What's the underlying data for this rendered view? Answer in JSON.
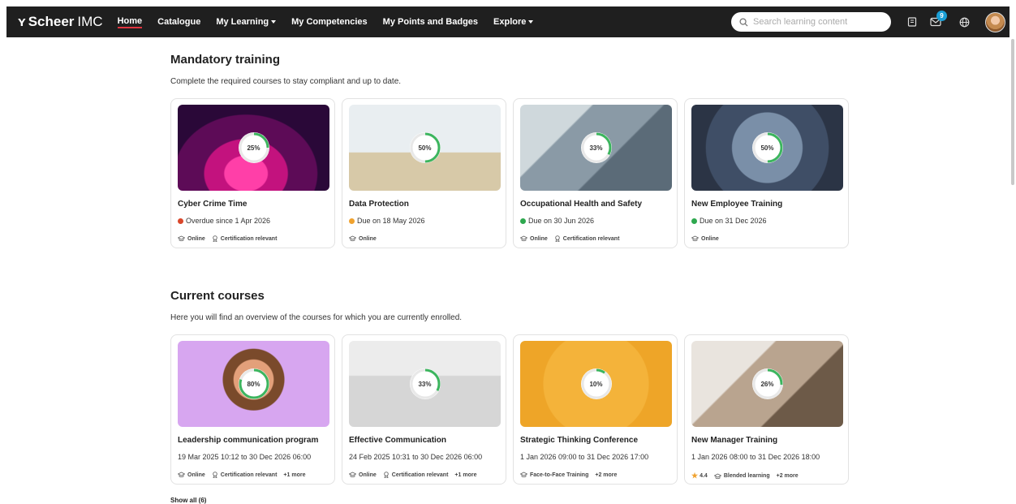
{
  "brand": {
    "mark": "ʏ",
    "name_bold": "Scheer",
    "name_light": "IMC"
  },
  "nav": [
    {
      "label": "Home",
      "active": true,
      "dropdown": false
    },
    {
      "label": "Catalogue",
      "active": false,
      "dropdown": false
    },
    {
      "label": "My Learning",
      "active": false,
      "dropdown": true
    },
    {
      "label": "My Competencies",
      "active": false,
      "dropdown": false
    },
    {
      "label": "My Points and Badges",
      "active": false,
      "dropdown": false
    },
    {
      "label": "Explore",
      "active": false,
      "dropdown": true
    }
  ],
  "search": {
    "placeholder": "Search learning content"
  },
  "notifications": {
    "count": "9"
  },
  "mandatory": {
    "title": "Mandatory training",
    "subtitle": "Complete the required courses to stay compliant and up to date.",
    "cards": [
      {
        "title": "Cyber Crime Time",
        "progress_label": "25%",
        "progress": 0.25,
        "status": "Overdue since 1 Apr 2026",
        "status_color": "#d9472b",
        "tags": [
          "Online",
          "Certification relevant"
        ]
      },
      {
        "title": "Data Protection",
        "progress_label": "50%",
        "progress": 0.5,
        "status": "Due on 18 May 2026",
        "status_color": "#f0a22e",
        "tags": [
          "Online"
        ]
      },
      {
        "title": "Occupational Health and Safety",
        "progress_label": "33%",
        "progress": 0.33,
        "status": "Due on 30 Jun 2026",
        "status_color": "#2ea84f",
        "tags": [
          "Online",
          "Certification relevant"
        ]
      },
      {
        "title": "New Employee Training",
        "progress_label": "50%",
        "progress": 0.5,
        "status": "Due on 31 Dec 2026",
        "status_color": "#2ea84f",
        "tags": [
          "Online"
        ]
      }
    ]
  },
  "current": {
    "title": "Current courses",
    "subtitle": "Here you will find an overview of the courses for which you are currently enrolled.",
    "cards": [
      {
        "title": "Leadership communication program",
        "progress_label": "80%",
        "progress": 0.8,
        "dates": "19 Mar 2025 10:12 to 30 Dec 2026 06:00",
        "rating": "",
        "tags": [
          "Online",
          "Certification relevant"
        ],
        "more": "+1 more"
      },
      {
        "title": "Effective Communication",
        "progress_label": "33%",
        "progress": 0.33,
        "dates": "24 Feb 2025 10:31 to 30 Dec 2026 06:00",
        "rating": "",
        "tags": [
          "Online",
          "Certification relevant"
        ],
        "more": "+1 more"
      },
      {
        "title": "Strategic Thinking Conference",
        "progress_label": "10%",
        "progress": 0.1,
        "dates": "1 Jan 2026 09:00 to 31 Dec 2026 17:00",
        "rating": "",
        "tags": [
          "Face-to-Face Training"
        ],
        "more": "+2 more"
      },
      {
        "title": "New Manager Training",
        "progress_label": "26%",
        "progress": 0.26,
        "dates": "1 Jan 2026 08:00 to 31 Dec 2026 18:00",
        "rating": "4.4",
        "tags": [
          "Blended learning"
        ],
        "more": "+2 more"
      }
    ]
  },
  "show_all": "Show all (6)",
  "colors": {
    "progress": "#3cb55e",
    "nav_active": "#e0343f",
    "topbar": "#1f1f1f"
  }
}
